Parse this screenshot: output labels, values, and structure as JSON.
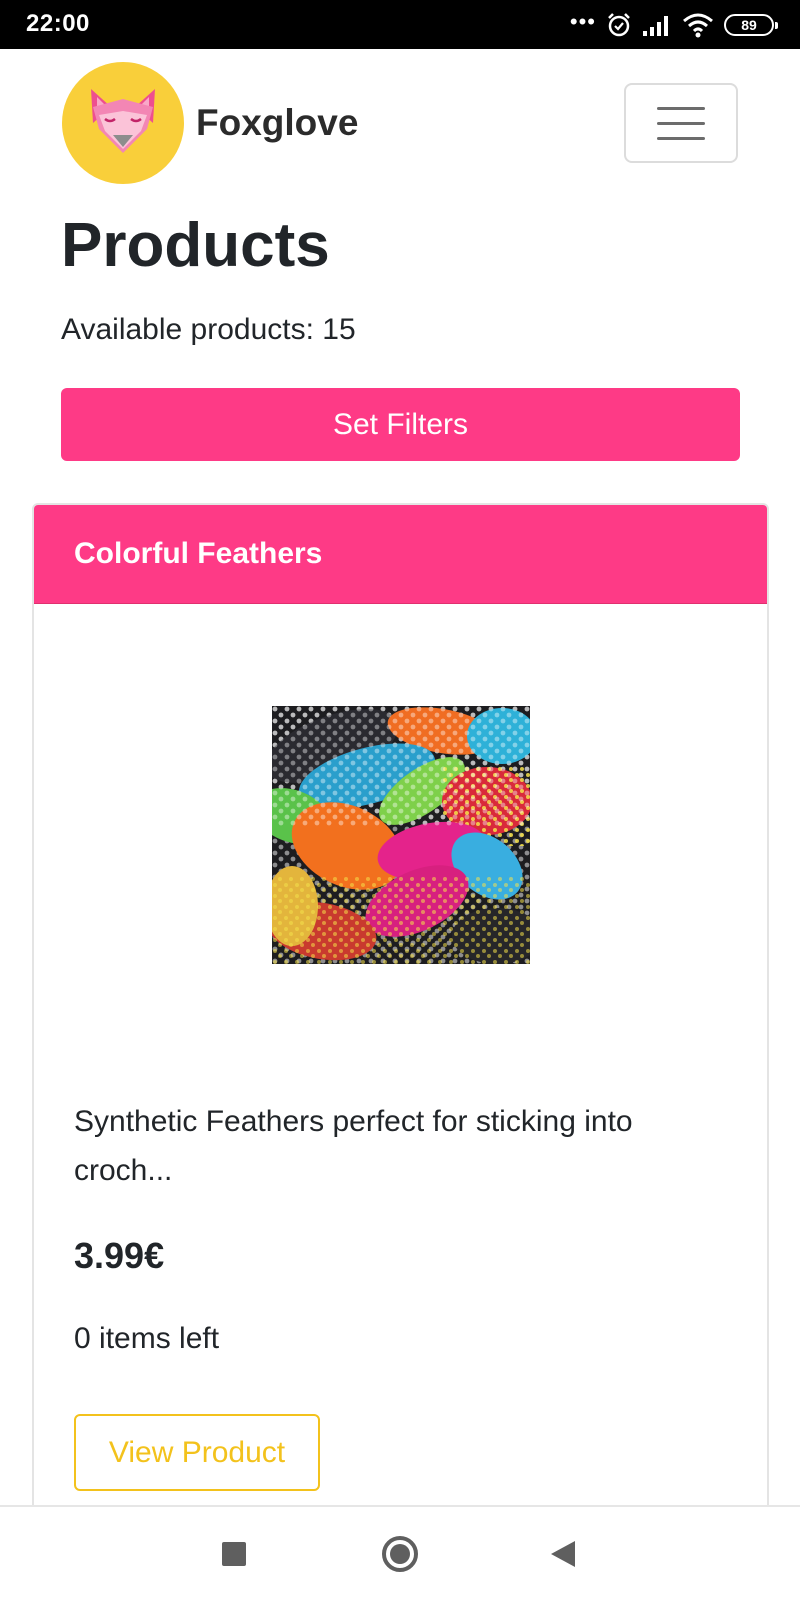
{
  "status_bar": {
    "time": "22:00",
    "battery": "89",
    "icons": [
      "more-dots-icon",
      "alarm-icon",
      "signal-icon",
      "wifi-icon",
      "battery-icon"
    ]
  },
  "navbar": {
    "brand_name": "Foxglove",
    "logo_icon": "fox-logo-icon",
    "menu_icon": "hamburger-menu-icon"
  },
  "page": {
    "title": "Products",
    "available_label": "Available products:",
    "available_count": "15",
    "filters_button": "Set Filters"
  },
  "product": {
    "name": "Colorful Feathers",
    "image_icon": "feathers-image",
    "description": "Synthetic Feathers perfect for sticking into croch...",
    "price": "3.99€",
    "stock_count": "0",
    "stock_label": "items left",
    "view_button": "View Product"
  },
  "system_nav": {
    "icons": [
      "recents-square-icon",
      "home-circle-icon",
      "back-triangle-icon"
    ]
  },
  "colors": {
    "accent_pink": "#fe3a86",
    "accent_yellow": "#f3c21c",
    "logo_yellow": "#f9cf3a"
  }
}
